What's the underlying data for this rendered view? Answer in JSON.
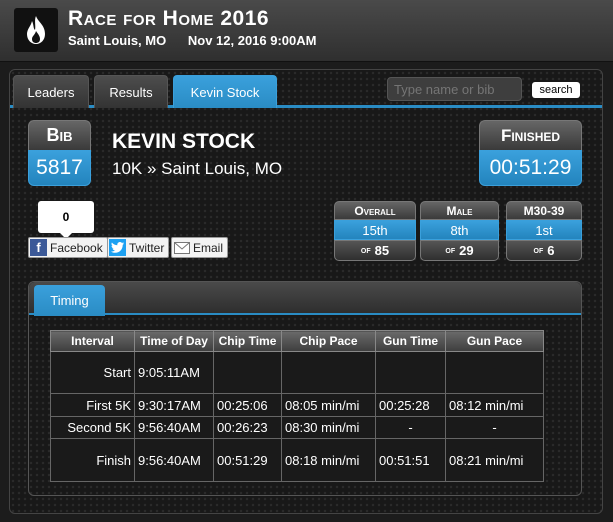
{
  "header": {
    "title": "Race for Home 2016",
    "location": "Saint Louis, MO",
    "datetime": "Nov 12, 2016 9:00AM",
    "logo_icon": "flame-icon"
  },
  "tabs": [
    "Leaders",
    "Results",
    "Kevin Stock"
  ],
  "search": {
    "placeholder": "Type name or bib",
    "button": "search"
  },
  "bib": {
    "label": "Bib",
    "value": "5817"
  },
  "runner": {
    "name": "KEVIN STOCK",
    "event": "10K » Saint Louis, MO"
  },
  "finished": {
    "label": "Finished",
    "value": "00:51:29"
  },
  "social": {
    "likes": "0",
    "facebook": "Facebook",
    "twitter": "Twitter",
    "email": "Email"
  },
  "ranks": [
    {
      "label": "Overall",
      "place": "15th",
      "of_label": "of",
      "total": "85"
    },
    {
      "label": "Male",
      "place": "8th",
      "of_label": "of",
      "total": "29"
    },
    {
      "label": "M30-39",
      "place": "1st",
      "of_label": "of",
      "total": "6"
    }
  ],
  "timing": {
    "tab": "Timing",
    "columns": [
      "Interval",
      "Time of Day",
      "Chip Time",
      "Chip Pace",
      "Gun Time",
      "Gun Pace"
    ],
    "rows": [
      [
        "Start",
        "9:05:11AM",
        "",
        "",
        "",
        ""
      ],
      [
        "First 5K",
        "9:30:17AM",
        "00:25:06",
        "08:05 min/mi",
        "00:25:28",
        "08:12 min/mi"
      ],
      [
        "Second 5K",
        "9:56:40AM",
        "00:26:23",
        "08:30 min/mi",
        "-",
        "-"
      ],
      [
        "Finish",
        "9:56:40AM",
        "00:51:29",
        "08:18 min/mi",
        "00:51:51",
        "08:21 min/mi"
      ]
    ]
  },
  "colors": {
    "accent": "#2a8cc4",
    "background": "#1c1c1c"
  }
}
